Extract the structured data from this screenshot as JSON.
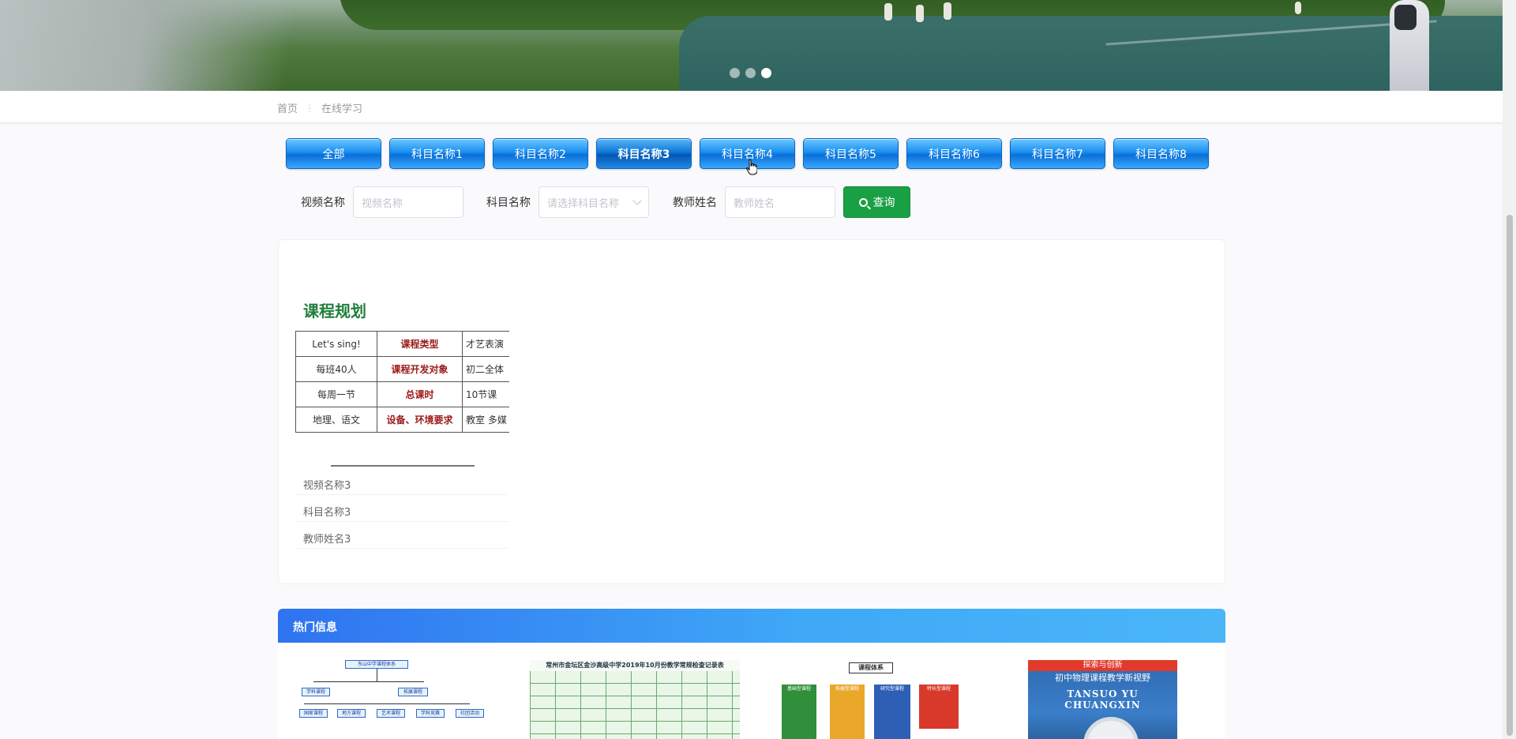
{
  "banner": {
    "slides": 3,
    "active_slide": 3
  },
  "breadcrumb": {
    "home": "首页",
    "separator": "⋮",
    "current": "在线学习"
  },
  "tabs": [
    {
      "label": "全部"
    },
    {
      "label": "科目名称1"
    },
    {
      "label": "科目名称2"
    },
    {
      "label": "科目名称3"
    },
    {
      "label": "科目名称4"
    },
    {
      "label": "科目名称5"
    },
    {
      "label": "科目名称6"
    },
    {
      "label": "科目名称7"
    },
    {
      "label": "科目名称8"
    }
  ],
  "active_tab": "科目名称3",
  "search": {
    "video_label": "视频名称",
    "video_placeholder": "视频名称",
    "subject_label": "科目名称",
    "subject_placeholder": "请选择科目名称",
    "teacher_label": "教师姓名",
    "teacher_placeholder": "教师姓名",
    "query_label": "查询"
  },
  "course_card": {
    "title": "课程规划",
    "rows": [
      [
        "Let's sing!",
        "课程类型",
        "才艺表演"
      ],
      [
        "每班40人",
        "课程开发对象",
        "初二全体"
      ],
      [
        "每周一节",
        "总课时",
        "10节课"
      ],
      [
        "地理、语文",
        "设备、环境要求",
        "教室 多媒"
      ]
    ],
    "video_name": "视频名称3",
    "subject_name": "科目名称3",
    "teacher_name": "教师姓名3"
  },
  "hot": {
    "title": "热门信息",
    "item1": {
      "org_top": "东山中学课程体系",
      "org_left": "学科课程",
      "org_right": "拓展课程",
      "org_leaves": [
        "国家课程",
        "地方课程",
        "艺术课程",
        "学科竞赛",
        "社团活动"
      ]
    },
    "item2": {
      "sheet_title": "常州市金坛区金沙高级中学2019年10月份教学常规检查记录表"
    },
    "item3": {
      "title": "课程体系",
      "columns": [
        "基础型课程",
        "拓展型课程",
        "研究型课程",
        "特长型课程"
      ]
    },
    "item4": {
      "headline": "探索与创新",
      "subtitle": "初中物理课程教学新视野",
      "pinyin": "TANSUO YU CHUANGXIN"
    }
  },
  "colors": {
    "tab_blue": "#1a8ef0",
    "query_green": "#1aa044",
    "title_green": "#1f7f3a",
    "label_red": "#9c1a1a"
  }
}
